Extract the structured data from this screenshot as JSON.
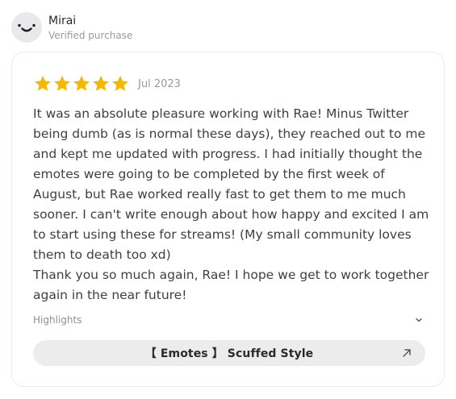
{
  "reviewer": {
    "name": "Mirai",
    "subtitle": "Verified purchase",
    "avatar_icon": "smiley-face-icon"
  },
  "review": {
    "rating": 5,
    "rating_max": 5,
    "star_color": "#f5b800",
    "date": "Jul 2023",
    "paragraphs": [
      "It was an absolute pleasure working with Rae! Minus Twitter being dumb (as is normal these days), they reached out to me and kept me updated with progress. I had initially thought the emotes were going to be completed by the first week of August, but Rae worked really fast to get them to me much sooner. I can't write enough about how happy and excited I am to start using these for streams! (My small community loves them to death too xd)",
      "Thank you so much again, Rae! I hope we get to work together again in the near future!"
    ]
  },
  "highlights": {
    "label": "Highlights",
    "icon": "chevron-down-icon"
  },
  "product": {
    "label": "【 Emotes 】 Scuffed Style",
    "icon": "arrow-up-right-icon"
  }
}
